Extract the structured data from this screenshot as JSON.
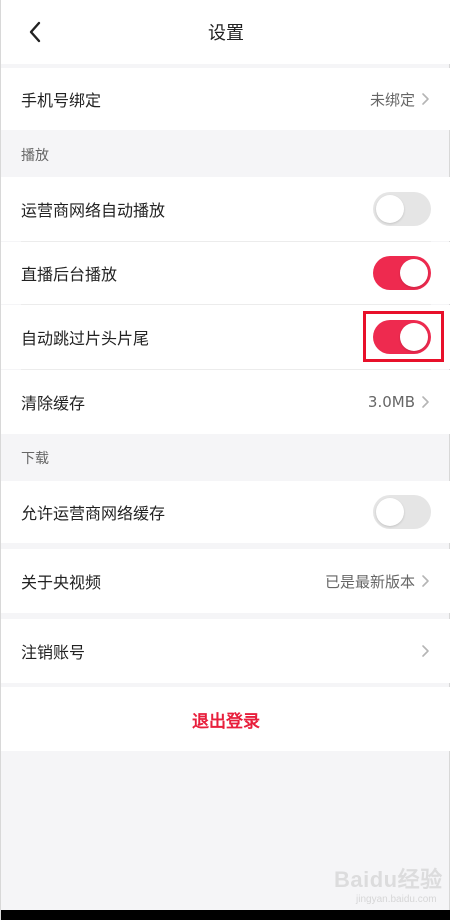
{
  "header": {
    "title": "设置",
    "back_icon": "chevron-left-icon"
  },
  "account": {
    "phone_label": "手机号绑定",
    "phone_value": "未绑定"
  },
  "playback": {
    "section_title": "播放",
    "items": [
      {
        "label": "运营商网络自动播放",
        "toggle": false
      },
      {
        "label": "直播后台播放",
        "toggle": true
      },
      {
        "label": "自动跳过片头片尾",
        "toggle": true
      }
    ],
    "clear_cache_label": "清除缓存",
    "clear_cache_value": "3.0MB"
  },
  "download": {
    "section_title": "下载",
    "carrier_cache_label": "允许运营商网络缓存",
    "carrier_cache_toggle": false
  },
  "about": {
    "label": "关于央视频",
    "value": "已是最新版本"
  },
  "cancel_account": {
    "label": "注销账号"
  },
  "logout": {
    "label": "退出登录"
  },
  "watermark": {
    "logo_text": "Baidu经验",
    "url": "jingyan.baidu.com"
  },
  "colors": {
    "accent": "#ee2a4f",
    "logout_text": "#e81f3c",
    "highlight_border": "#e8102a",
    "toggle_off": "#e5e5e5",
    "background": "#f5f5f7"
  }
}
